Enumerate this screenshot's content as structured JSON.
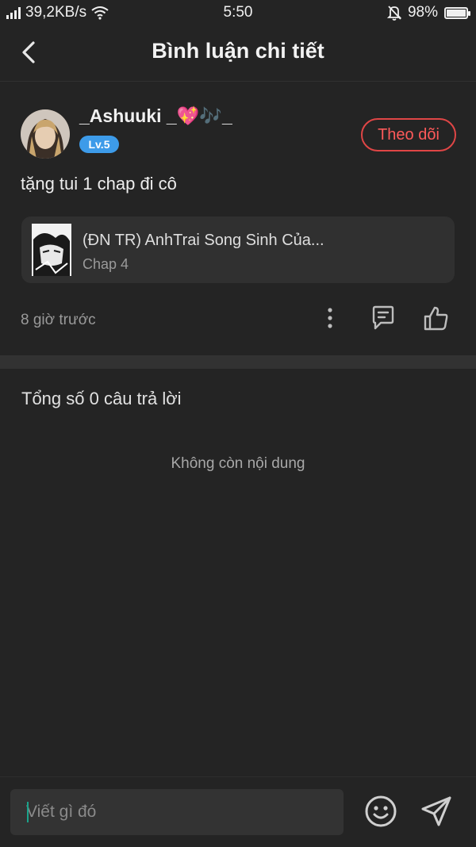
{
  "status_bar": {
    "net_speed": "39,2KB/s",
    "time": "5:50",
    "battery": "98%",
    "battery_level": 0.98
  },
  "header": {
    "title": "Bình luận chi tiết",
    "back_icon": "chevron-left-icon"
  },
  "comment": {
    "username": "_Ashuuki _💖🎶_",
    "level": "Lv.5",
    "follow_label": "Theo dõi",
    "text": "tặng tui 1 chap đi cô",
    "reference": {
      "title": "(ĐN TR) AnhTrai Song Sinh Của...",
      "chapter": "Chap 4"
    },
    "time": "8 giờ trước",
    "actions": [
      "more-vertical-icon",
      "comment-icon",
      "thumbs-up-icon"
    ]
  },
  "replies": {
    "total_label": "Tổng số 0 câu trả lời",
    "empty_label": "Không còn nội dung"
  },
  "composer": {
    "placeholder": "Viết gì đó",
    "emoji_icon": "smile-icon",
    "send_icon": "send-icon"
  },
  "colors": {
    "background": "#242424",
    "accent_red": "#e04646",
    "level_blue": "#3d9be9",
    "caret_teal": "#1aa38b"
  }
}
